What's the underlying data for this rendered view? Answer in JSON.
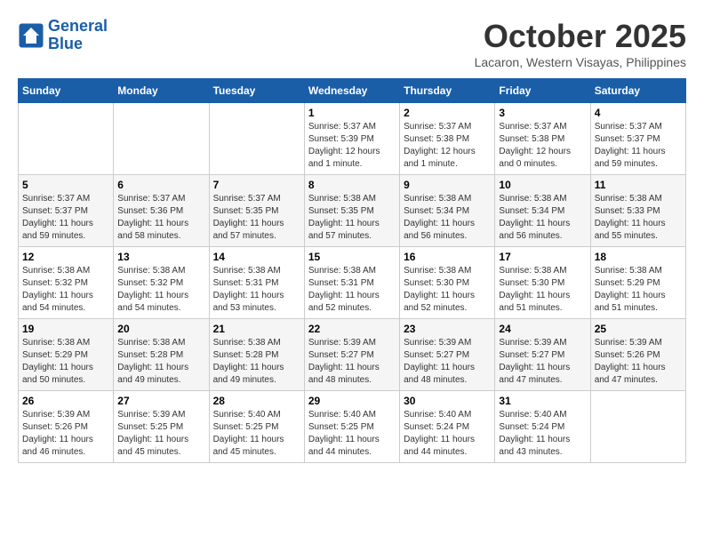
{
  "header": {
    "logo_line1": "General",
    "logo_line2": "Blue",
    "month": "October 2025",
    "location": "Lacaron, Western Visayas, Philippines"
  },
  "days_of_week": [
    "Sunday",
    "Monday",
    "Tuesday",
    "Wednesday",
    "Thursday",
    "Friday",
    "Saturday"
  ],
  "weeks": [
    [
      {
        "day": "",
        "info": ""
      },
      {
        "day": "",
        "info": ""
      },
      {
        "day": "",
        "info": ""
      },
      {
        "day": "1",
        "info": "Sunrise: 5:37 AM\nSunset: 5:39 PM\nDaylight: 12 hours\nand 1 minute."
      },
      {
        "day": "2",
        "info": "Sunrise: 5:37 AM\nSunset: 5:38 PM\nDaylight: 12 hours\nand 1 minute."
      },
      {
        "day": "3",
        "info": "Sunrise: 5:37 AM\nSunset: 5:38 PM\nDaylight: 12 hours\nand 0 minutes."
      },
      {
        "day": "4",
        "info": "Sunrise: 5:37 AM\nSunset: 5:37 PM\nDaylight: 11 hours\nand 59 minutes."
      }
    ],
    [
      {
        "day": "5",
        "info": "Sunrise: 5:37 AM\nSunset: 5:37 PM\nDaylight: 11 hours\nand 59 minutes."
      },
      {
        "day": "6",
        "info": "Sunrise: 5:37 AM\nSunset: 5:36 PM\nDaylight: 11 hours\nand 58 minutes."
      },
      {
        "day": "7",
        "info": "Sunrise: 5:37 AM\nSunset: 5:35 PM\nDaylight: 11 hours\nand 57 minutes."
      },
      {
        "day": "8",
        "info": "Sunrise: 5:38 AM\nSunset: 5:35 PM\nDaylight: 11 hours\nand 57 minutes."
      },
      {
        "day": "9",
        "info": "Sunrise: 5:38 AM\nSunset: 5:34 PM\nDaylight: 11 hours\nand 56 minutes."
      },
      {
        "day": "10",
        "info": "Sunrise: 5:38 AM\nSunset: 5:34 PM\nDaylight: 11 hours\nand 56 minutes."
      },
      {
        "day": "11",
        "info": "Sunrise: 5:38 AM\nSunset: 5:33 PM\nDaylight: 11 hours\nand 55 minutes."
      }
    ],
    [
      {
        "day": "12",
        "info": "Sunrise: 5:38 AM\nSunset: 5:32 PM\nDaylight: 11 hours\nand 54 minutes."
      },
      {
        "day": "13",
        "info": "Sunrise: 5:38 AM\nSunset: 5:32 PM\nDaylight: 11 hours\nand 54 minutes."
      },
      {
        "day": "14",
        "info": "Sunrise: 5:38 AM\nSunset: 5:31 PM\nDaylight: 11 hours\nand 53 minutes."
      },
      {
        "day": "15",
        "info": "Sunrise: 5:38 AM\nSunset: 5:31 PM\nDaylight: 11 hours\nand 52 minutes."
      },
      {
        "day": "16",
        "info": "Sunrise: 5:38 AM\nSunset: 5:30 PM\nDaylight: 11 hours\nand 52 minutes."
      },
      {
        "day": "17",
        "info": "Sunrise: 5:38 AM\nSunset: 5:30 PM\nDaylight: 11 hours\nand 51 minutes."
      },
      {
        "day": "18",
        "info": "Sunrise: 5:38 AM\nSunset: 5:29 PM\nDaylight: 11 hours\nand 51 minutes."
      }
    ],
    [
      {
        "day": "19",
        "info": "Sunrise: 5:38 AM\nSunset: 5:29 PM\nDaylight: 11 hours\nand 50 minutes."
      },
      {
        "day": "20",
        "info": "Sunrise: 5:38 AM\nSunset: 5:28 PM\nDaylight: 11 hours\nand 49 minutes."
      },
      {
        "day": "21",
        "info": "Sunrise: 5:38 AM\nSunset: 5:28 PM\nDaylight: 11 hours\nand 49 minutes."
      },
      {
        "day": "22",
        "info": "Sunrise: 5:39 AM\nSunset: 5:27 PM\nDaylight: 11 hours\nand 48 minutes."
      },
      {
        "day": "23",
        "info": "Sunrise: 5:39 AM\nSunset: 5:27 PM\nDaylight: 11 hours\nand 48 minutes."
      },
      {
        "day": "24",
        "info": "Sunrise: 5:39 AM\nSunset: 5:27 PM\nDaylight: 11 hours\nand 47 minutes."
      },
      {
        "day": "25",
        "info": "Sunrise: 5:39 AM\nSunset: 5:26 PM\nDaylight: 11 hours\nand 47 minutes."
      }
    ],
    [
      {
        "day": "26",
        "info": "Sunrise: 5:39 AM\nSunset: 5:26 PM\nDaylight: 11 hours\nand 46 minutes."
      },
      {
        "day": "27",
        "info": "Sunrise: 5:39 AM\nSunset: 5:25 PM\nDaylight: 11 hours\nand 45 minutes."
      },
      {
        "day": "28",
        "info": "Sunrise: 5:40 AM\nSunset: 5:25 PM\nDaylight: 11 hours\nand 45 minutes."
      },
      {
        "day": "29",
        "info": "Sunrise: 5:40 AM\nSunset: 5:25 PM\nDaylight: 11 hours\nand 44 minutes."
      },
      {
        "day": "30",
        "info": "Sunrise: 5:40 AM\nSunset: 5:24 PM\nDaylight: 11 hours\nand 44 minutes."
      },
      {
        "day": "31",
        "info": "Sunrise: 5:40 AM\nSunset: 5:24 PM\nDaylight: 11 hours\nand 43 minutes."
      },
      {
        "day": "",
        "info": ""
      }
    ]
  ]
}
